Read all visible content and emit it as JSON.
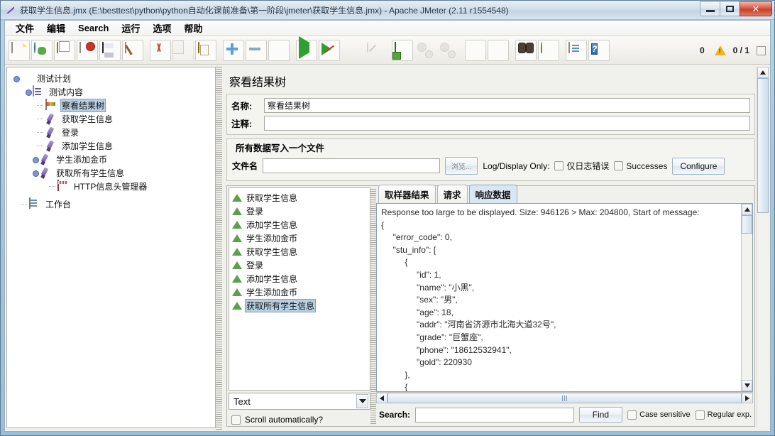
{
  "window": {
    "title": "获取学生信息.jmx (E:\\besttest\\python\\python自动化课前准备\\第一阶段\\jmeter\\获取学生信息.jmx) - Apache JMeter (2.11 r1554548)",
    "minimize_label": "",
    "maximize_label": "",
    "close_label": "✕"
  },
  "menu": {
    "items": [
      {
        "label": "文件"
      },
      {
        "label": "编辑"
      },
      {
        "label": "Search"
      },
      {
        "label": "运行"
      },
      {
        "label": "选项"
      },
      {
        "label": "帮助"
      }
    ]
  },
  "toolbar": {
    "buttons": [
      {
        "name": "new-icon",
        "title": "新建"
      },
      {
        "name": "templates-icon",
        "title": "模板"
      },
      {
        "name": "open-icon",
        "title": "打开"
      },
      {
        "name": "close-icon",
        "title": "关闭"
      },
      {
        "name": "save-icon",
        "title": "保存"
      },
      {
        "name": "save-as-icon",
        "title": "保存为"
      },
      {
        "name": "cut-icon",
        "title": "剪切"
      },
      {
        "name": "copy-icon",
        "title": "复制"
      },
      {
        "name": "paste-icon",
        "title": "粘贴"
      },
      {
        "name": "expand-icon",
        "title": "展开"
      },
      {
        "name": "collapse-icon",
        "title": "收起"
      },
      {
        "name": "toggle-icon",
        "title": "切换"
      },
      {
        "name": "start-icon",
        "title": "启动"
      },
      {
        "name": "start-no-pauses-icon",
        "title": "无间隔启动"
      },
      {
        "name": "stop-icon",
        "title": "停止"
      },
      {
        "name": "shutdown-icon",
        "title": "关闭"
      },
      {
        "name": "remote-start-all-icon",
        "title": "远程全部启动"
      },
      {
        "name": "remote-stop-all-icon",
        "title": "远程全部停止"
      },
      {
        "name": "remote-shutdown-all-icon",
        "title": "远程全部关闭"
      },
      {
        "name": "clear-icon",
        "title": "清除"
      },
      {
        "name": "clear-all-icon",
        "title": "清除全部"
      },
      {
        "name": "search-icon",
        "title": "查找"
      },
      {
        "name": "reset-search-icon",
        "title": "重置查找"
      },
      {
        "name": "function-helper-icon",
        "title": "函数助手"
      },
      {
        "name": "help-icon",
        "title": "帮助"
      }
    ],
    "warning_count": "0",
    "thread_counter": "0 / 1"
  },
  "tree": {
    "nodes": [
      {
        "label": "测试计划",
        "icon": "test-plan-icon",
        "depth": 0,
        "selected": false,
        "expanded": true
      },
      {
        "label": "测试内容",
        "icon": "thread-group-icon",
        "depth": 1,
        "selected": false,
        "expanded": true
      },
      {
        "label": "察看结果树",
        "icon": "view-results-tree-icon",
        "depth": 2,
        "selected": true,
        "expanded": false
      },
      {
        "label": "获取学生信息",
        "icon": "http-sampler-icon",
        "depth": 2,
        "selected": false,
        "expanded": false
      },
      {
        "label": "登录",
        "icon": "http-sampler-icon",
        "depth": 2,
        "selected": false,
        "expanded": false
      },
      {
        "label": "添加学生信息",
        "icon": "http-sampler-icon",
        "depth": 2,
        "selected": false,
        "expanded": false
      },
      {
        "label": "学生添加金币",
        "icon": "http-sampler-icon",
        "depth": 2,
        "selected": false,
        "expanded": true
      },
      {
        "label": "获取所有学生信息",
        "icon": "http-sampler-icon",
        "depth": 2,
        "selected": false,
        "expanded": true
      },
      {
        "label": "HTTP信息头管理器",
        "icon": "header-manager-icon",
        "depth": 3,
        "selected": false,
        "expanded": false
      },
      {
        "label": "工作台",
        "icon": "workbench-icon",
        "depth": 0,
        "selected": false,
        "expanded": false
      }
    ]
  },
  "pane": {
    "title": "察看结果树",
    "name_label": "名称:",
    "name_value": "察看结果树",
    "comment_label": "注释:",
    "comment_value": "",
    "file_group_title": "所有数据写入一个文件",
    "filename_label": "文件名",
    "filename_value": "",
    "filename_placeholder": "",
    "browse_label": "浏览...",
    "log_display_label": "Log/Display Only:",
    "errors_only_label": "仅日志错误",
    "successes_label": "Successes",
    "configure_label": "Configure"
  },
  "results": {
    "items": [
      {
        "label": "获取学生信息",
        "status": "success",
        "selected": false
      },
      {
        "label": "登录",
        "status": "success",
        "selected": false
      },
      {
        "label": "添加学生信息",
        "status": "success",
        "selected": false
      },
      {
        "label": "学生添加金币",
        "status": "success",
        "selected": false
      },
      {
        "label": "获取学生信息",
        "status": "success",
        "selected": false
      },
      {
        "label": "登录",
        "status": "success",
        "selected": false
      },
      {
        "label": "添加学生信息",
        "status": "success",
        "selected": false
      },
      {
        "label": "学生添加金币",
        "status": "success",
        "selected": false
      },
      {
        "label": "获取所有学生信息",
        "status": "success",
        "selected": true
      }
    ],
    "renderer_selected": "Text",
    "scroll_automatically_label": "Scroll automatically?"
  },
  "detail": {
    "tabs": [
      {
        "label": "取样器结果",
        "active": false
      },
      {
        "label": "请求",
        "active": false
      },
      {
        "label": "响应数据",
        "active": true
      }
    ],
    "response_text": "Response too large to be displayed. Size: 946126 > Max: 204800, Start of message:\n{\n     \"error_code\": 0,\n     \"stu_info\": [\n          {\n               \"id\": 1,\n               \"name\": \"小黑\",\n               \"sex\": \"男\",\n               \"age\": 18,\n               \"addr\": \"河南省济源市北海大道32号\",\n               \"grade\": \"巨蟹座\",\n               \"phone\": \"18612532941\",\n               \"gold\": 220930\n          },\n          {",
    "search_label": "Search:",
    "search_value": "",
    "find_label": "Find",
    "case_sensitive_label": "Case sensitive",
    "regular_exp_label": "Regular exp."
  },
  "colors": {
    "selection": "#b8cfe4",
    "tab_active": "#d9e7f5",
    "success": "#5ba04a",
    "warning": "#f0b323",
    "close_button": "#c6402b"
  }
}
